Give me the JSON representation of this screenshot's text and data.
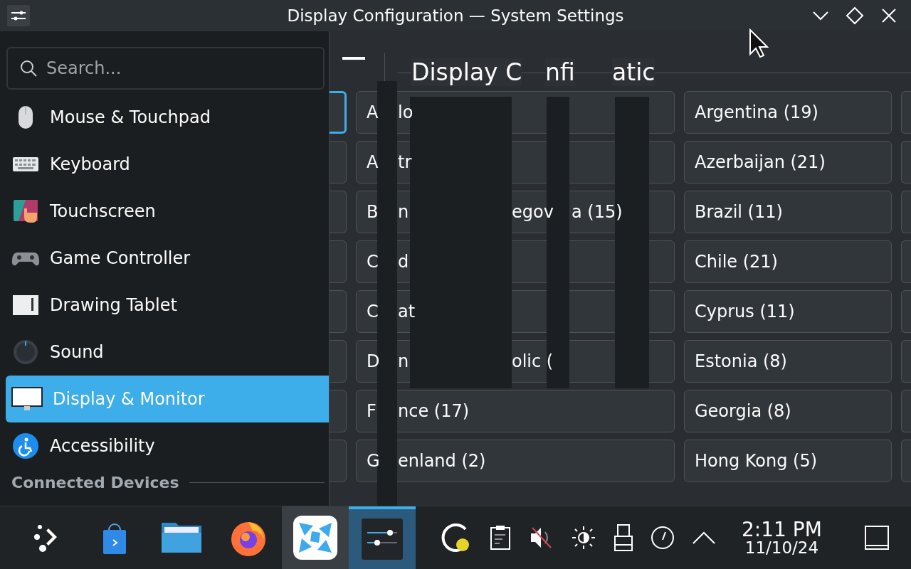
{
  "window": {
    "title": "Display Configuration — System Settings"
  },
  "sidebar": {
    "search": {
      "placeholder": "Search..."
    },
    "items": [
      {
        "label": "Mouse & Touchpad",
        "selected": false
      },
      {
        "label": "Keyboard",
        "selected": false
      },
      {
        "label": "Touchscreen",
        "selected": false
      },
      {
        "label": "Game Controller",
        "selected": false
      },
      {
        "label": "Drawing Tablet",
        "selected": false
      },
      {
        "label": "Sound",
        "selected": false
      },
      {
        "label": "Display & Monitor",
        "selected": true
      },
      {
        "label": "Accessibility",
        "selected": false
      }
    ],
    "section_heading": "Connected Devices"
  },
  "page": {
    "title_fragments": [
      "Display C",
      "nfi",
      "atic"
    ],
    "previous_column": [
      {
        "selected": true
      },
      {
        "selected": false
      },
      {
        "selected": false
      },
      {
        "selected": false
      },
      {
        "selected": false
      },
      {
        "selected": false
      },
      {
        "selected": false
      },
      {
        "selected": false
      }
    ],
    "left_column": [
      {
        "fragments": [
          "A",
          "lo"
        ]
      },
      {
        "fragments": [
          "A",
          "tr"
        ]
      },
      {
        "fragments": [
          "B",
          "n",
          "egov",
          "a (15)"
        ]
      },
      {
        "fragments": [
          "C",
          "d"
        ]
      },
      {
        "fragments": [
          "C",
          "at"
        ]
      },
      {
        "fragments": [
          "D",
          "n",
          "olic ("
        ]
      },
      {
        "fragments": [
          "F",
          "nce (17)"
        ]
      },
      {
        "fragments": [
          "G",
          "enland (2)"
        ]
      }
    ],
    "right_column": [
      "Argentina (19)",
      "Azerbaijan (21)",
      "Brazil (11)",
      "Chile (21)",
      "Cyprus (11)",
      "Estonia (8)",
      "Georgia (8)",
      "Hong Kong (5)"
    ]
  },
  "taskbar": {
    "tasks": [
      {
        "selected": false,
        "hovered": false
      },
      {
        "selected": false,
        "hovered": false
      },
      {
        "selected": false,
        "hovered": false
      },
      {
        "selected": false,
        "hovered": false
      },
      {
        "selected": false,
        "hovered": true
      },
      {
        "selected": true,
        "hovered": false
      }
    ],
    "clock": {
      "time": "2:11 PM",
      "date": "11/10/24"
    }
  }
}
